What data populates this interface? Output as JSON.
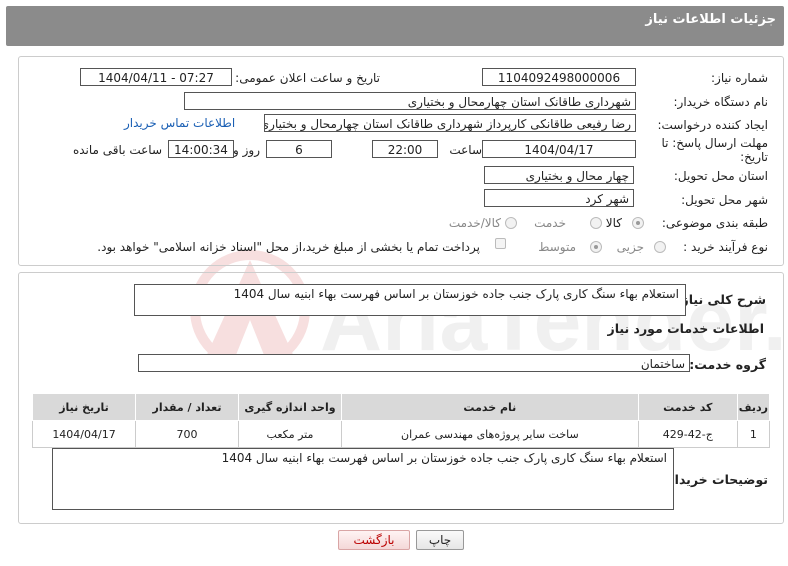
{
  "header": {
    "title": "جزئیات اطلاعات نیاز"
  },
  "fields": {
    "need_number_label": "شماره نیاز:",
    "need_number": "1104092498000006",
    "announce_label": "تاریخ و ساعت اعلان عمومی:",
    "announce_value": "1404/04/11 - 07:27",
    "buyer_org_label": "نام دستگاه خریدار:",
    "buyer_org": "شهرداری طاقانک استان چهارمحال و بختیاری",
    "creator_label": "ایجاد کننده درخواست:",
    "creator": "رضا رفیعی طاقانکی کارپرداز شهرداری طاقانک استان چهارمحال و بختیاری",
    "contact_link": "اطلاعات تماس خریدار",
    "deadline_label_1": "مهلت ارسال پاسخ: تا",
    "deadline_label_2": "تاریخ:",
    "deadline_date": "1404/04/17",
    "time_label": "ساعت",
    "deadline_time": "22:00",
    "days_value": "6",
    "days_label": "روز و",
    "remaining_time": "14:00:34",
    "remaining_label": "ساعت باقی مانده",
    "province_label": "استان محل تحویل:",
    "province": "چهار محال و بختیاری",
    "city_label": "شهر محل تحویل:",
    "city": "شهر کرد",
    "category_label": "طبقه بندی موضوعی:",
    "category_options": [
      "کالا",
      "خدمت",
      "کالا/خدمت"
    ],
    "category_selected": 0,
    "process_label": "نوع فرآیند خرید :",
    "process_options": [
      "جزیی",
      "متوسط"
    ],
    "process_selected": 0,
    "payment_note": "پرداخت تمام یا بخشی از مبلغ خرید،از محل \"اسناد خزانه اسلامی\" خواهد بود."
  },
  "summary": {
    "label": "شرح کلی نیاز:",
    "text": "استعلام بهاء سنگ کاری پارک جنب جاده خوزستان بر اساس فهرست بهاء ابنیه سال 1404"
  },
  "services": {
    "section_title": "اطلاعات خدمات مورد نیاز",
    "group_label": "گروه خدمت:",
    "group_value": "ساختمان",
    "columns": [
      "ردیف",
      "کد خدمت",
      "نام خدمت",
      "واحد اندازه گیری",
      "تعداد / مقدار",
      "تاریخ نیاز"
    ],
    "rows": [
      [
        "1",
        "ج-42-429",
        "ساخت سایر پروژه‌های مهندسی عمران",
        "متر مکعب",
        "700",
        "1404/04/17"
      ]
    ]
  },
  "buyer_notes": {
    "label": "توضیحات خریدار:",
    "text": "استعلام بهاء سنگ کاری پارک جنب جاده خوزستان بر اساس فهرست بهاء ابنیه سال 1404"
  },
  "buttons": {
    "print": "چاپ",
    "back": "بازگشت"
  },
  "watermark": {
    "text": "AriaTender.neT",
    "icon": "aria-logo-icon"
  },
  "colors": {
    "header_bg": "#8b8b8b",
    "link": "#1a5fb4",
    "back_text": "#b00000"
  }
}
